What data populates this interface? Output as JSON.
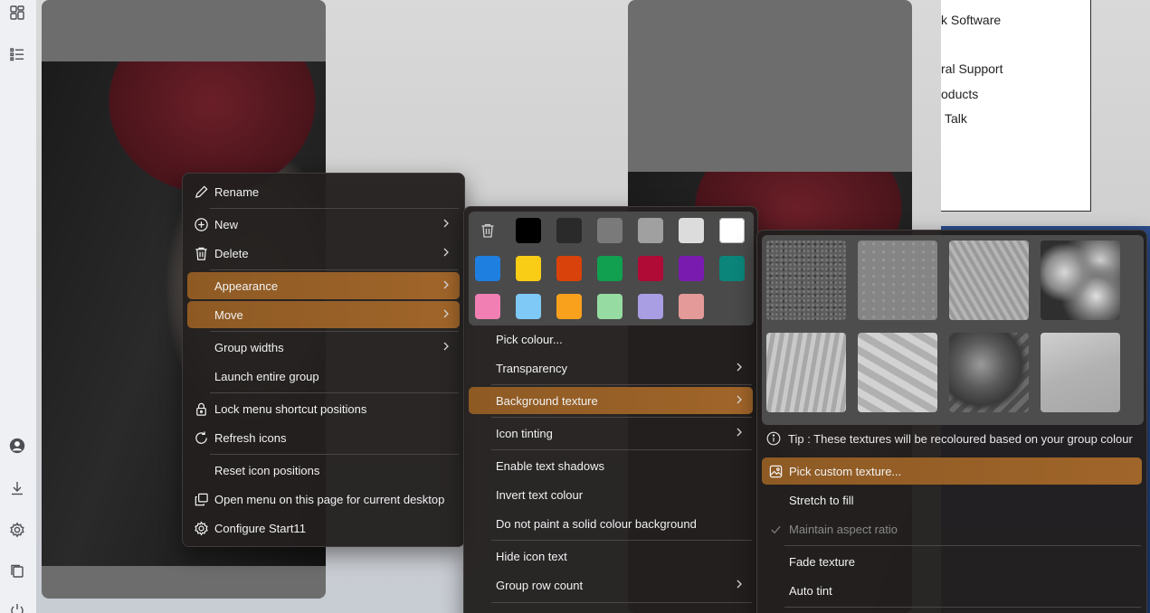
{
  "rail": {
    "icons": [
      "grid-icon",
      "list-icon",
      "user-icon",
      "download-icon",
      "gear-icon",
      "files-icon",
      "power-icon"
    ]
  },
  "doc": {
    "items": [
      "k Software",
      "ral Support",
      "oducts",
      "Talk"
    ]
  },
  "main_menu": {
    "items": [
      {
        "label": "Rename",
        "icon": "pencil-icon"
      },
      {
        "label": "New",
        "icon": "plus-circle-icon",
        "submenu": true
      },
      {
        "label": "Delete",
        "icon": "trash-icon",
        "submenu": true
      },
      {
        "label": "Appearance",
        "submenu": true,
        "selected": true
      },
      {
        "label": "Move",
        "submenu": true,
        "selected": true
      },
      {
        "label": "Group widths",
        "submenu": true
      },
      {
        "label": "Launch entire group"
      },
      {
        "label": "Lock menu shortcut positions",
        "icon": "lock-icon"
      },
      {
        "label": "Refresh icons",
        "icon": "refresh-icon"
      },
      {
        "label": "Reset icon positions"
      },
      {
        "label": "Open menu on this page for current desktop",
        "icon": "window-copy-icon"
      },
      {
        "label": "Configure Start11",
        "icon": "gear-icon"
      }
    ]
  },
  "appearance_menu": {
    "swatches": [
      "#000000",
      "#2a2a2a",
      "#7a7a7a",
      "#a0a0a0",
      "#dcdcdc",
      "#ffffff",
      "#1f7fe0",
      "#f9cc16",
      "#d9420a",
      "#10a050",
      "#b00a36",
      "#7a1bb0",
      "#0b857a",
      "#f27fb3",
      "#7ec9f6",
      "#f9a11d",
      "#96dca2",
      "#a99ee4",
      "#e59a9a"
    ],
    "items": [
      {
        "label": "Pick colour..."
      },
      {
        "label": "Transparency",
        "submenu": true
      },
      {
        "label": "Background texture",
        "submenu": true,
        "selected": true
      },
      {
        "label": "Icon tinting",
        "submenu": true
      },
      {
        "label": "Enable text shadows"
      },
      {
        "label": "Invert text colour"
      },
      {
        "label": "Do not paint a solid colour background"
      },
      {
        "label": "Hide icon text"
      },
      {
        "label": "Group row count",
        "submenu": true
      }
    ]
  },
  "texture_menu": {
    "tip": "Tip : These textures will be recoloured based on your group colour",
    "items": [
      {
        "label": "Pick custom texture...",
        "icon": "image-icon",
        "selected": true
      },
      {
        "label": "Stretch to fill"
      },
      {
        "label": "Maintain aspect ratio",
        "checked": true,
        "disabled": true
      },
      {
        "label": "Fade texture"
      },
      {
        "label": "Auto tint"
      }
    ]
  }
}
